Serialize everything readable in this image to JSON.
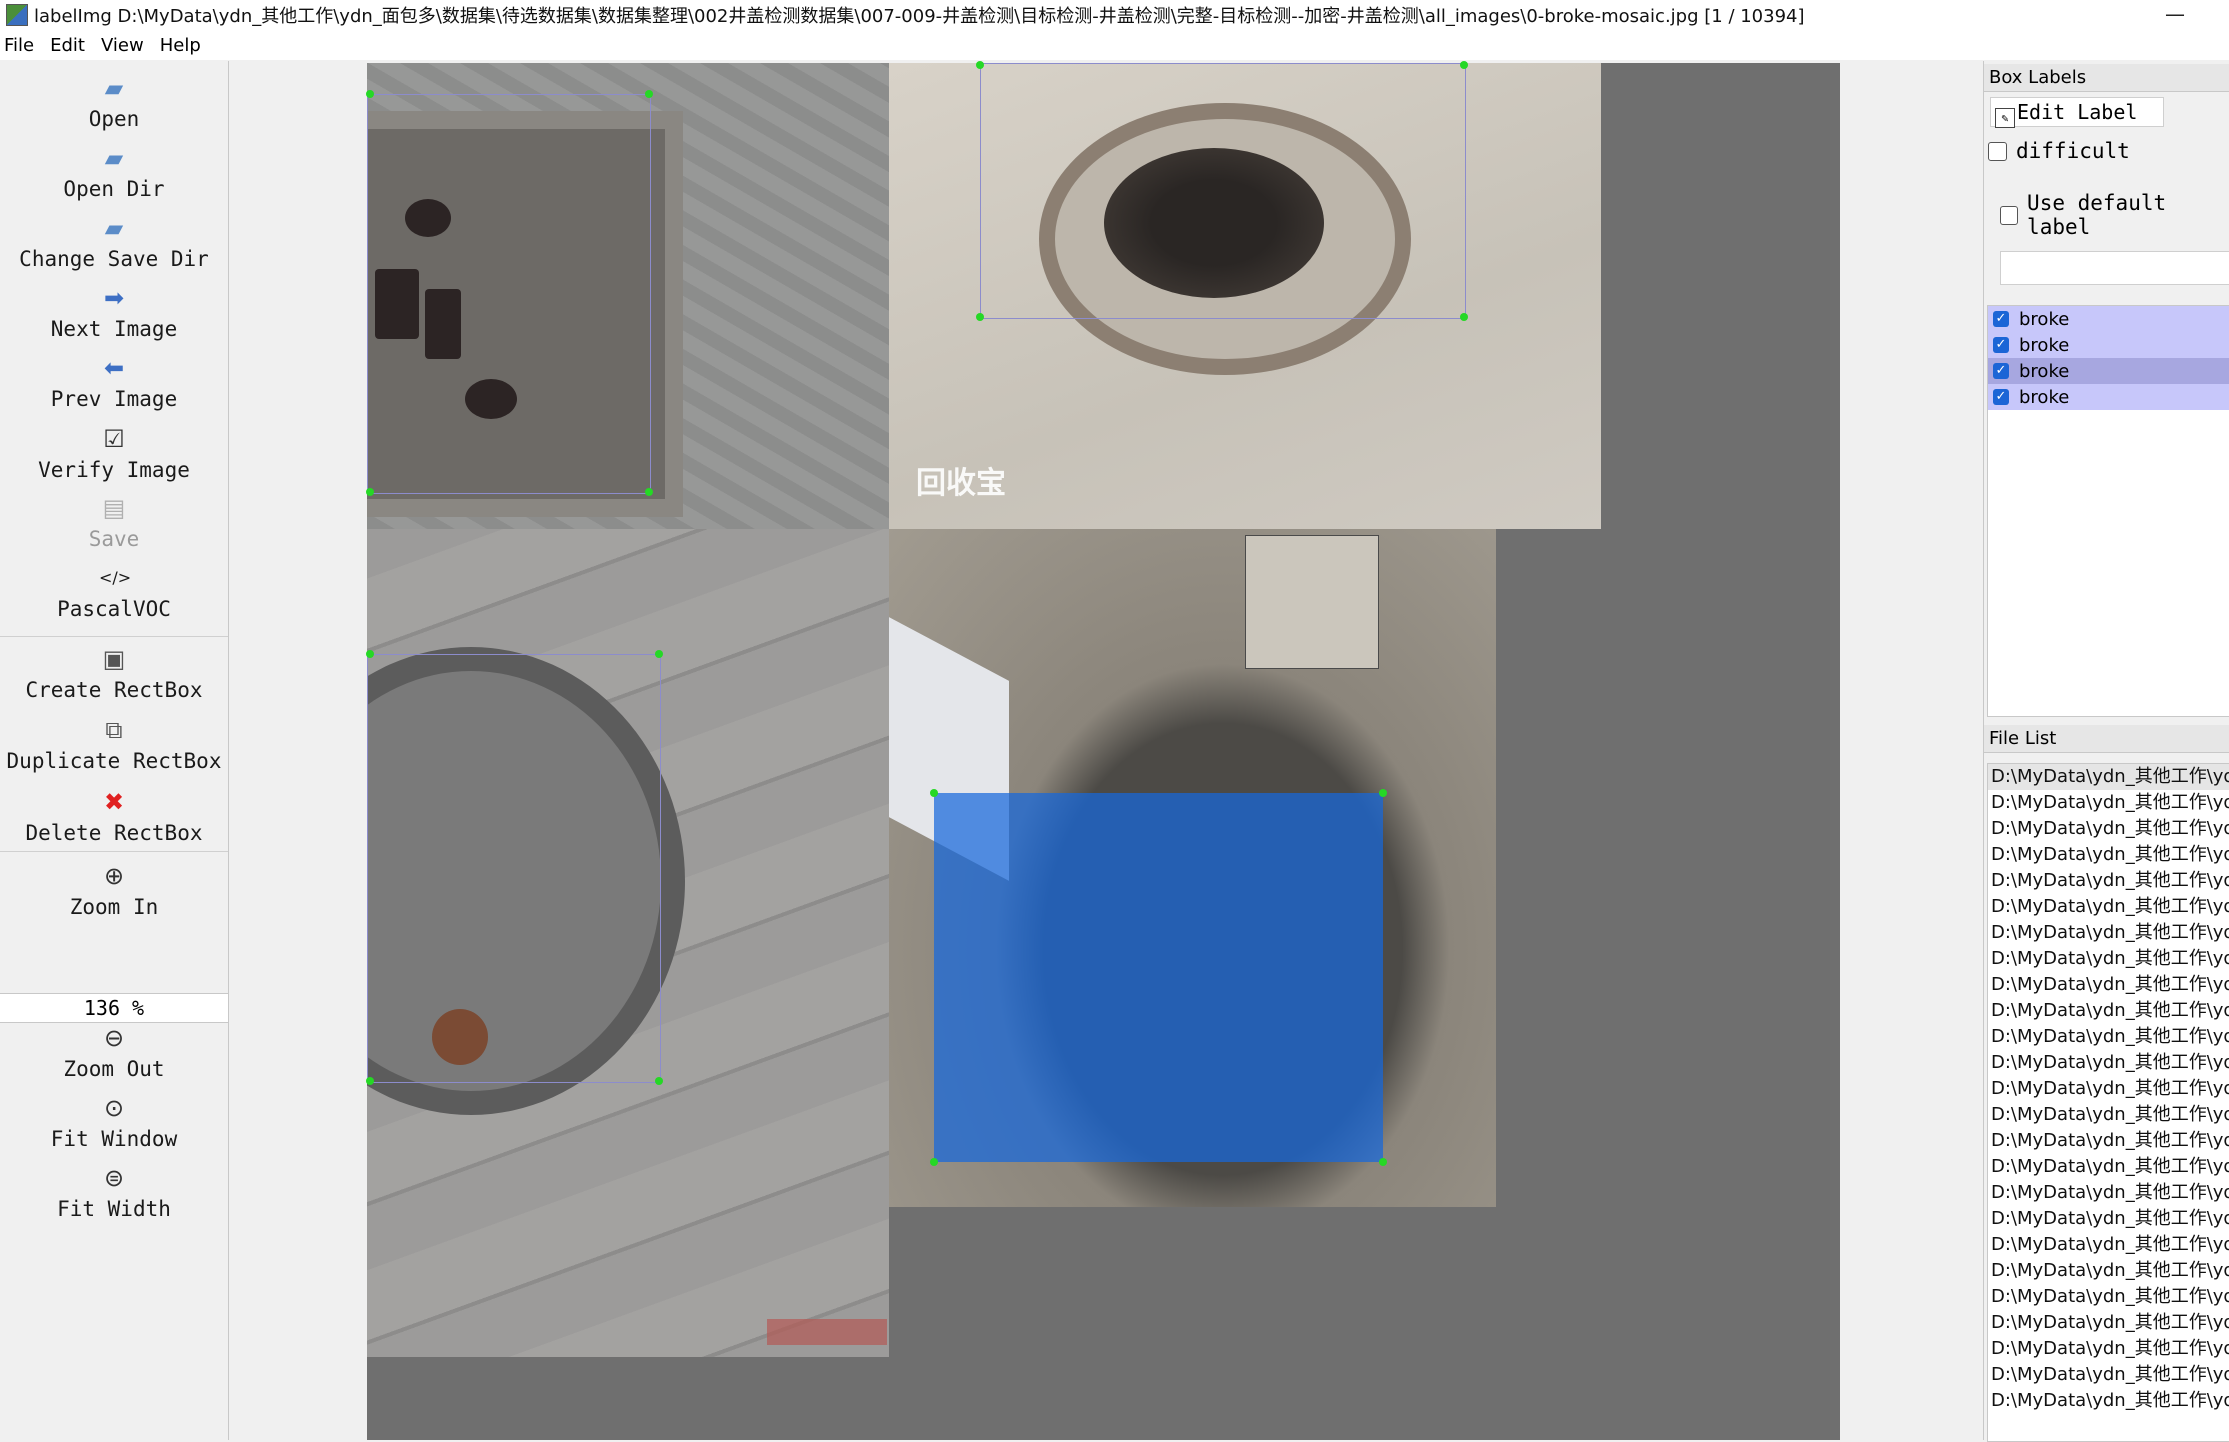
{
  "window": {
    "title": "labelImg D:\\MyData\\ydn_其他工作\\ydn_面包多\\数据集\\待选数据集\\数据集整理\\002井盖检测数据集\\007-009-井盖检测\\目标检测-井盖检测\\完整-目标检测--加密-井盖检测\\all_images\\0-broke-mosaic.jpg [1 / 10394]",
    "minimize": "—"
  },
  "menu": [
    "File",
    "Edit",
    "View",
    "Help"
  ],
  "toolbar": {
    "open": "Open",
    "open_dir": "Open Dir",
    "change_save_dir": "Change Save Dir",
    "next_image": "Next Image",
    "prev_image": "Prev Image",
    "verify_image": "Verify Image",
    "save": "Save",
    "format_icon": "</>",
    "format": "PascalVOC",
    "create_rectbox": "Create RectBox",
    "duplicate_rectbox": "Duplicate RectBox",
    "delete_rectbox": "Delete RectBox",
    "zoom_in": "Zoom In",
    "zoom_value": "136 %",
    "zoom_out": "Zoom Out",
    "fit_window": "Fit Window",
    "fit_width": "Fit Width"
  },
  "canvas": {
    "watermark": "回收宝"
  },
  "box_labels": {
    "title": "Box Labels",
    "edit_label": "Edit Label",
    "difficult": "difficult",
    "use_default_label": "Use default label",
    "default_label_value": "",
    "labels": [
      "broke",
      "broke",
      "broke",
      "broke"
    ]
  },
  "file_list": {
    "title": "File List",
    "items": [
      "D:\\MyData\\ydn_其他工作\\yd",
      "D:\\MyData\\ydn_其他工作\\yd",
      "D:\\MyData\\ydn_其他工作\\yd",
      "D:\\MyData\\ydn_其他工作\\yd",
      "D:\\MyData\\ydn_其他工作\\yd",
      "D:\\MyData\\ydn_其他工作\\yd",
      "D:\\MyData\\ydn_其他工作\\yd",
      "D:\\MyData\\ydn_其他工作\\yd",
      "D:\\MyData\\ydn_其他工作\\yd",
      "D:\\MyData\\ydn_其他工作\\yd",
      "D:\\MyData\\ydn_其他工作\\yd",
      "D:\\MyData\\ydn_其他工作\\yd",
      "D:\\MyData\\ydn_其他工作\\yd",
      "D:\\MyData\\ydn_其他工作\\yd",
      "D:\\MyData\\ydn_其他工作\\yd",
      "D:\\MyData\\ydn_其他工作\\yd",
      "D:\\MyData\\ydn_其他工作\\yd",
      "D:\\MyData\\ydn_其他工作\\yd",
      "D:\\MyData\\ydn_其他工作\\yd",
      "D:\\MyData\\ydn_其他工作\\yd",
      "D:\\MyData\\ydn_其他工作\\yd",
      "D:\\MyData\\ydn_其他工作\\yd",
      "D:\\MyData\\ydn_其他工作\\yd",
      "D:\\MyData\\ydn_其他工作\\yd",
      "D:\\MyData\\ydn_其他工作\\yd"
    ]
  },
  "colors": {
    "selected_box": "#1668dc",
    "label_row": "#c7c7fa",
    "vertex": "#25d825"
  }
}
